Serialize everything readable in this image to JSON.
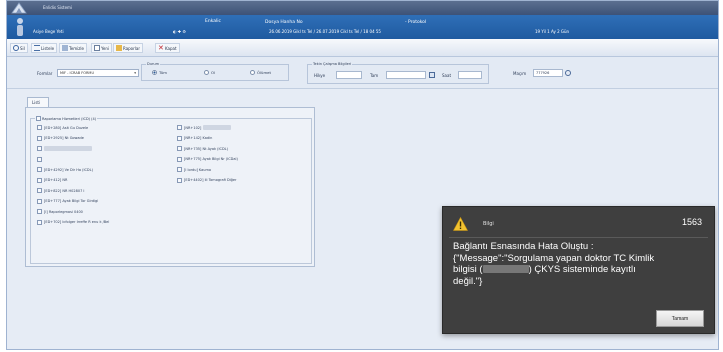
{
  "window": {
    "title": "Enlidis Sistemi"
  },
  "header": {
    "user": "Asiye Bege Yeti",
    "mode": "Enkalic",
    "dossier_label": "Dosya Hanha No",
    "protocol_label": "- Protokol",
    "dates": "26.06.2019 Gikl ts Tel / 26.07.2019 Cikl ts Tel / 18 04 55",
    "age": "19 Yil 1 Ay 2 Gün",
    "colors": {
      "topbar": "#4a6086",
      "infobar": "#2566ad",
      "dialog": "#3f3f3f"
    }
  },
  "toolbar": {
    "buttons": [
      {
        "label": "Sil",
        "icon": "search-icon"
      },
      {
        "label": "Listele",
        "icon": "list-icon"
      },
      {
        "label": "Temizle",
        "icon": "clear-icon"
      },
      {
        "label": "Yeni",
        "icon": "new-icon"
      },
      {
        "label": "Raporlar",
        "icon": "report-icon"
      },
      {
        "label": "Kapat",
        "icon": "close-icon"
      }
    ]
  },
  "filters": {
    "form_label": "Formlar",
    "form_value": "MIF - ICRAB FORMU",
    "status_group": "Durum",
    "radios": [
      {
        "label": "Tüm",
        "selected": true
      },
      {
        "label": "Ol",
        "selected": false
      },
      {
        "label": "Ölümet",
        "selected": false
      }
    ],
    "date_group": "Tekin Çalışma Bilgileri",
    "date_from_label": "Hikye",
    "date_to_label": "Tam",
    "count_label": "Saat",
    "search_label": "Maçım",
    "search_value": "777926"
  },
  "tab": {
    "label": "Listi"
  },
  "groupbox": {
    "title": "Raporlama Hizmetleri (ICD) (4)"
  },
  "left_items": [
    "[ED+280] Asit Gu Duzele",
    "[ED+2925] Nt Gowade",
    "",
    "",
    "[ED+4292] Ve Dir Ha (ICDL)",
    "[ED+412] NR",
    "[ED+822] NR H02807 I",
    "[ED+777] Ayak Bilgi Tor Girdigi",
    "[I] Raporlegmasi 0400",
    "[ED+702] Icfolger Irreffe R enu k /Bel"
  ],
  "right_items": [
    "[NR+102]",
    "[NR+142] Kadin",
    "[NR+735] Nt Ayak (ICDL)",
    "[NR+775] Ayak Bilgi Nr (ICDal)",
    "[I lordu] Kaumo",
    "[ED+4402] ili Tomografi Diğer"
  ],
  "dialog": {
    "caption": "Bilgi",
    "code": "1563",
    "line1": "Bağlantı Esnasında Hata Oluştu :",
    "line2": "{\"Message\":\"Sorgulama yapan doktor TC Kimlik",
    "line3a": "bilgisi (",
    "line3b": ") ÇKYS sisteminde kayıtlı",
    "line4": "değil.\"}",
    "ok_label": "Tamam"
  }
}
